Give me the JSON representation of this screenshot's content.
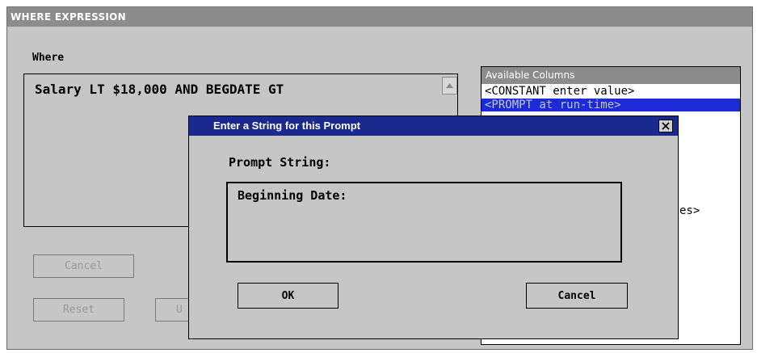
{
  "window": {
    "title": "WHERE EXPRESSION"
  },
  "where": {
    "label": "Where",
    "expression": "Salary LT $18,000 AND BEGDATE GT"
  },
  "buttons": {
    "cancel": "Cancel",
    "reset": "Reset",
    "partial_hidden": "U"
  },
  "columns": {
    "header": "Available Columns",
    "items": [
      "<CONSTANT enter value>",
      "<PROMPT at run-time>"
    ],
    "partial_hidden_item": "es>"
  },
  "dialog": {
    "title": "Enter a String for this Prompt",
    "prompt_label": "Prompt String:",
    "prompt_value": "Beginning Date:",
    "ok": "OK",
    "cancel": "Cancel"
  },
  "colors": {
    "dialog_title_bg": "#1a2a8e",
    "selection_bg": "#1c2ad8",
    "window_bg": "#c6c6c6",
    "title_bg": "#8c8c8c"
  }
}
